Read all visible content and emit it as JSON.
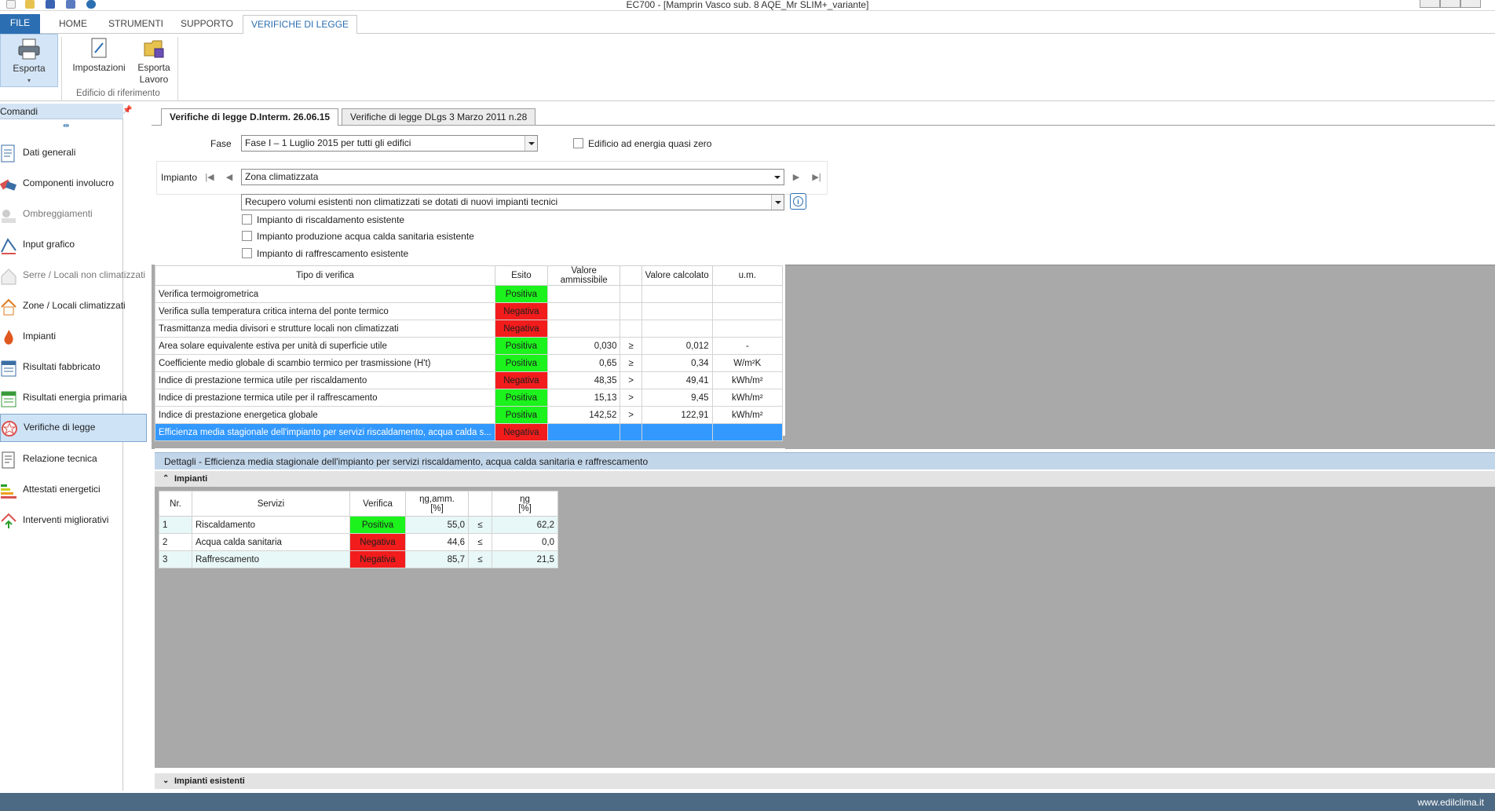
{
  "window": {
    "title": "EC700 - [Mamprin Vasco sub. 8 AQE_Mr SLIM+_variante]"
  },
  "ribbon": {
    "tabs": [
      "FILE",
      "HOME",
      "STRUMENTI",
      "SUPPORTO",
      "VERIFICHE DI LEGGE"
    ],
    "active_tab": "VERIFICHE DI LEGGE",
    "buttons": {
      "esporta": "Esporta",
      "impostazioni": "Impostazioni",
      "esporta_lavoro_1": "Esporta",
      "esporta_lavoro_2": "Lavoro"
    },
    "group_label": "Edificio di riferimento"
  },
  "sidebar": {
    "title": "Comandi",
    "items": [
      {
        "label": "Dati generali"
      },
      {
        "label": "Componenti involucro"
      },
      {
        "label": "Ombreggiamenti"
      },
      {
        "label": "Input grafico"
      },
      {
        "label": "Serre / Locali non climatizzati"
      },
      {
        "label": "Zone / Locali climatizzati"
      },
      {
        "label": "Impianti"
      },
      {
        "label": "Risultati fabbricato"
      },
      {
        "label": "Risultati energia primaria"
      },
      {
        "label": "Verifiche di legge"
      },
      {
        "label": "Relazione tecnica"
      },
      {
        "label": "Attestati energetici"
      },
      {
        "label": "Interventi migliorativi"
      }
    ],
    "selected": "Verifiche di legge"
  },
  "doc_tabs": [
    "Verifiche di legge D.Interm. 26.06.15",
    "Verifiche di legge DLgs 3 Marzo 2011 n.28"
  ],
  "form": {
    "fase_label": "Fase",
    "fase_value": "Fase I – 1 Luglio 2015 per tutti gli edifici",
    "nzeb_label": "Edificio ad energia quasi zero",
    "impianto_label": "Impianto",
    "impianto_value": "Zona climatizzata",
    "intervento_value": "Recupero volumi esistenti non climatizzati se dotati di nuovi impianti tecnici",
    "checks": [
      "Impianto di riscaldamento esistente",
      "Impianto produzione acqua calda sanitaria esistente",
      "Impianto di raffrescamento esistente"
    ]
  },
  "verifiche": {
    "headers": [
      "Tipo di verifica",
      "Esito",
      "Valore ammissibile",
      "",
      "Valore calcolato",
      "u.m."
    ],
    "rows": [
      {
        "tipo": "Verifica termoigrometrica",
        "esito": "Positiva",
        "amm": "",
        "op": "",
        "calc": "",
        "um": ""
      },
      {
        "tipo": "Verifica sulla temperatura critica interna del ponte termico",
        "esito": "Negativa",
        "amm": "",
        "op": "",
        "calc": "",
        "um": ""
      },
      {
        "tipo": "Trasmittanza media divisori e strutture locali non climatizzati",
        "esito": "Negativa",
        "amm": "",
        "op": "",
        "calc": "",
        "um": ""
      },
      {
        "tipo": "Area solare equivalente estiva per unità di superficie utile",
        "esito": "Positiva",
        "amm": "0,030",
        "op": "≥",
        "calc": "0,012",
        "um": "-"
      },
      {
        "tipo": "Coefficiente medio globale di scambio termico per trasmissione (H't)",
        "esito": "Positiva",
        "amm": "0,65",
        "op": "≥",
        "calc": "0,34",
        "um": "W/m²K"
      },
      {
        "tipo": "Indice di prestazione termica utile per riscaldamento",
        "esito": "Negativa",
        "amm": "48,35",
        "op": ">",
        "calc": "49,41",
        "um": "kWh/m²"
      },
      {
        "tipo": "Indice di prestazione termica utile per il raffrescamento",
        "esito": "Positiva",
        "amm": "15,13",
        "op": ">",
        "calc": "9,45",
        "um": "kWh/m²"
      },
      {
        "tipo": "Indice di prestazione energetica globale",
        "esito": "Positiva",
        "amm": "142,52",
        "op": ">",
        "calc": "122,91",
        "um": "kWh/m²"
      },
      {
        "tipo": "Efficienza media stagionale dell'impianto per servizi riscaldamento, acqua calda s...",
        "esito": "Negativa",
        "amm": "",
        "op": "",
        "calc": "",
        "um": ""
      }
    ]
  },
  "dettagli": {
    "title": "Dettagli - Efficienza media stagionale dell'impianto per servizi riscaldamento, acqua calda sanitaria e raffrescamento",
    "section_open": "Impianti",
    "section_closed": "Impianti esistenti",
    "headers": {
      "nr": "Nr.",
      "servizi": "Servizi",
      "verifica": "Verifica",
      "amm_1": "ηg,amm.",
      "amm_2": "[%]",
      "op": "",
      "ng_1": "ηg",
      "ng_2": "[%]"
    },
    "rows": [
      {
        "nr": "1",
        "servizio": "Riscaldamento",
        "verifica": "Positiva",
        "amm": "55,0",
        "op": "≤",
        "ng": "62,2"
      },
      {
        "nr": "2",
        "servizio": "Acqua calda sanitaria",
        "verifica": "Negativa",
        "amm": "44,6",
        "op": "≤",
        "ng": "0,0"
      },
      {
        "nr": "3",
        "servizio": "Raffrescamento",
        "verifica": "Negativa",
        "amm": "85,7",
        "op": "≤",
        "ng": "21,5"
      }
    ]
  },
  "status": {
    "site": "www.edilclima.it"
  },
  "colors": {
    "positive": "#1cf21c",
    "negative": "#f21c1c",
    "selection": "#3399ff",
    "accent": "#2b6eb2"
  }
}
